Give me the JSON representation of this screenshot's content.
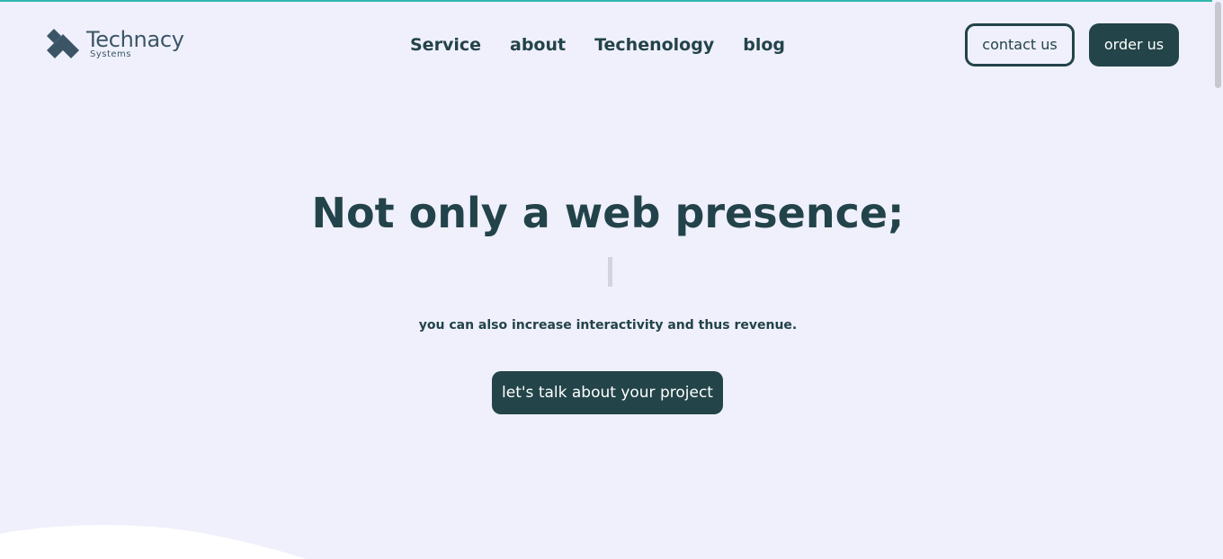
{
  "brand": {
    "name": "Technacy",
    "subtitle": "Systems"
  },
  "nav": {
    "items": [
      {
        "label": "Service"
      },
      {
        "label": "about"
      },
      {
        "label": "Techenology"
      },
      {
        "label": "blog"
      }
    ]
  },
  "header": {
    "contact_label": "contact us",
    "order_label": "order us"
  },
  "hero": {
    "title": "Not only a web presence;",
    "subtitle": "you can also increase interactivity and thus revenue.",
    "cta_label": "let's talk about your project"
  },
  "colors": {
    "background": "#eff0fc",
    "primary": "#234449",
    "accent_line": "#2fb8ad",
    "logo": "#3c5566"
  },
  "icons": {
    "logo": "technacy-diamond-logo-icon"
  }
}
